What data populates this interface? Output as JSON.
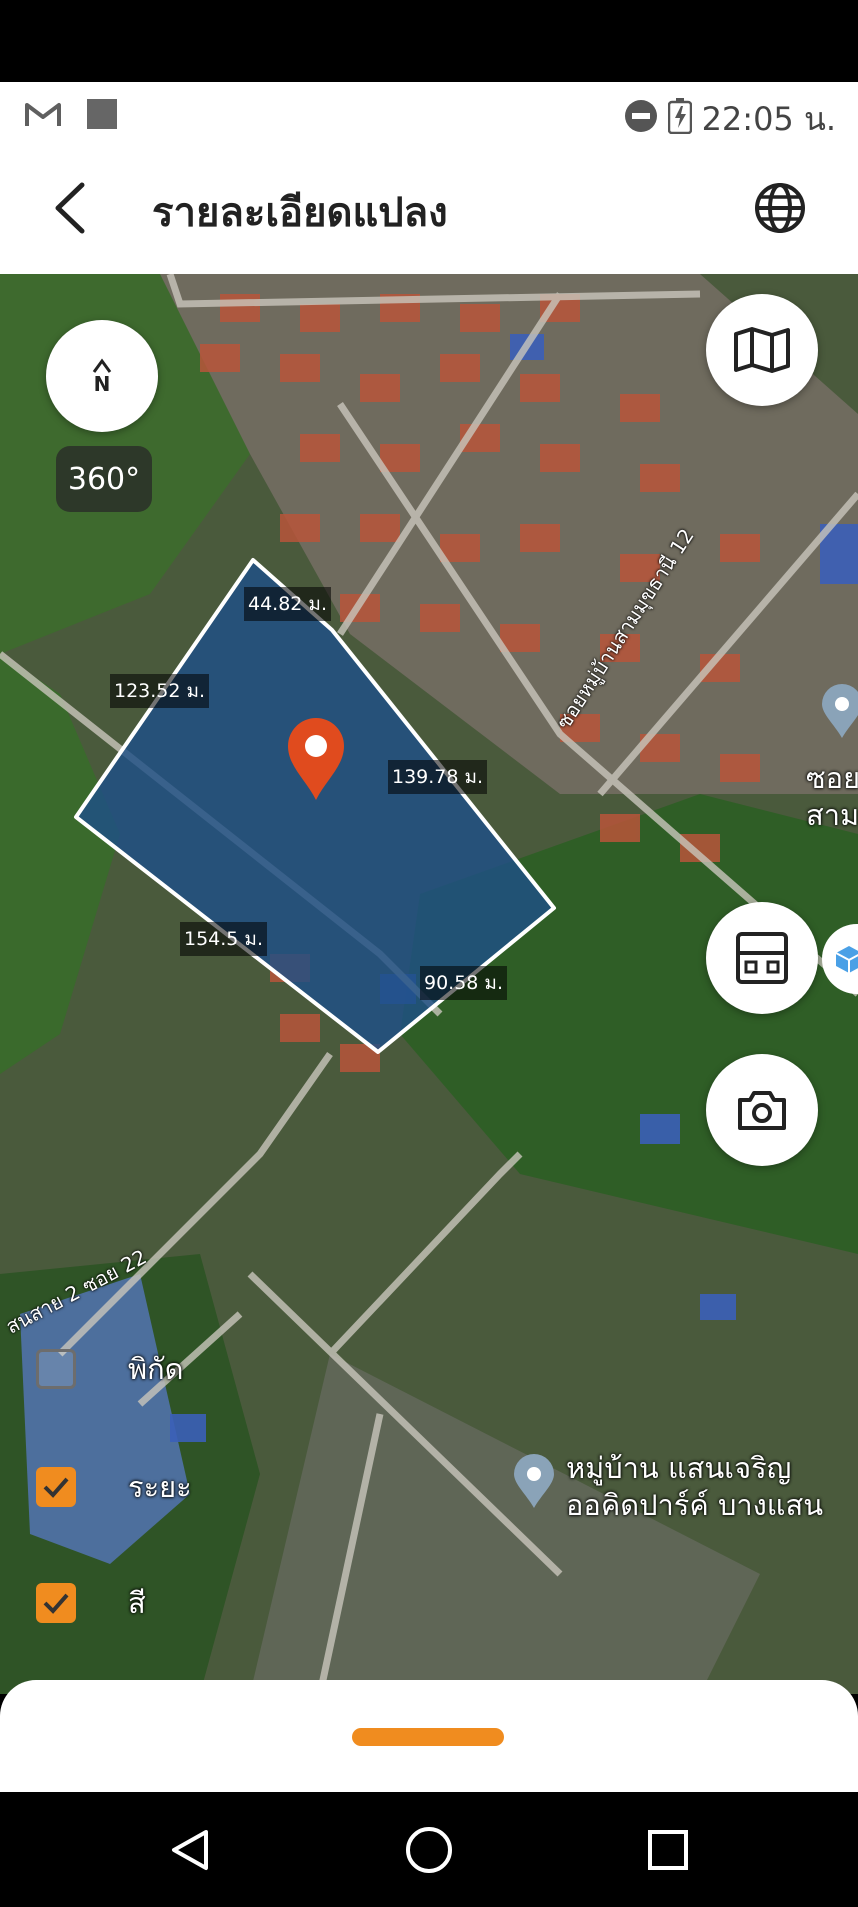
{
  "status_bar": {
    "time": "22:05 น.",
    "icons": [
      "gmail-icon",
      "square-notification-icon",
      "do-not-disturb-icon",
      "battery-charging-icon"
    ]
  },
  "app_bar": {
    "title": "รายละเอียดแปลง",
    "back_icon": "back-arrow-icon",
    "globe_icon": "globe-icon"
  },
  "map": {
    "compass_label": "N",
    "view_360_label": "360°",
    "plot_fill_color": "#1e4f86",
    "plot_border_color": "#ffffff",
    "marker_color": "#e04b1e",
    "dimensions": [
      {
        "id": "top",
        "label": "44.82 ม."
      },
      {
        "id": "left",
        "label": "123.52 ม."
      },
      {
        "id": "right",
        "label": "139.78 ม."
      },
      {
        "id": "bottom-left",
        "label": "154.5 ม."
      },
      {
        "id": "bottom-right",
        "label": "90.58 ม."
      }
    ],
    "road_labels": [
      {
        "id": "soi-12",
        "text": "ซอยหมู่บ้านสามมุขธานี 12"
      },
      {
        "id": "soi-22",
        "text": "สนสาย 2 ซอย 22"
      }
    ],
    "poi_labels": [
      {
        "id": "poi-right",
        "lines": [
          "ซอย",
          "สาม"
        ]
      },
      {
        "id": "poi-village",
        "lines": [
          "หมู่บ้าน แสนเจริญ",
          "ออคิดปาร์ค์ บางแสน"
        ]
      }
    ],
    "buttons": {
      "map_layers_icon": "map-icon",
      "calculator_icon": "calculator-icon",
      "camera_icon": "camera-icon"
    },
    "toggles": [
      {
        "id": "coordinates",
        "label": "พิกัด",
        "checked": false
      },
      {
        "id": "distance",
        "label": "ระยะ",
        "checked": true
      },
      {
        "id": "color",
        "label": "สี",
        "checked": true
      }
    ],
    "accent_color": "#f08c1f"
  },
  "nav_bar": {
    "icons": [
      "back-triangle-icon",
      "home-circle-icon",
      "recents-square-icon"
    ]
  }
}
